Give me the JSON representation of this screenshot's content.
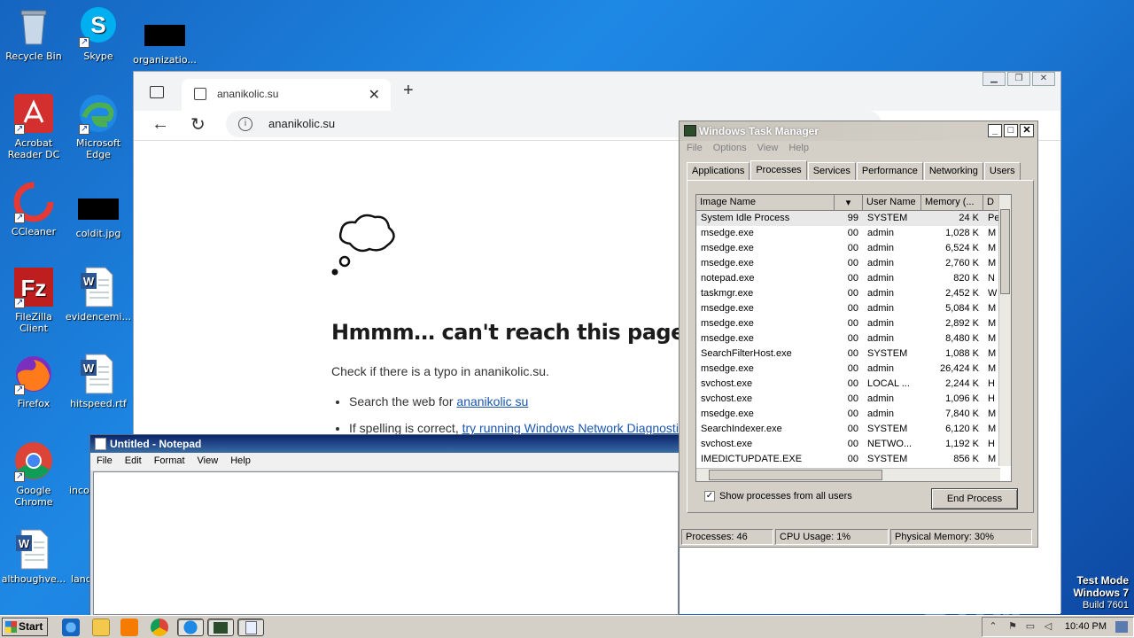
{
  "desktop": {
    "icons": [
      {
        "label": "Recycle Bin"
      },
      {
        "label": "Skype"
      },
      {
        "label": "organizatio..."
      },
      {
        "label": "Acrobat Reader DC"
      },
      {
        "label": "Microsoft Edge"
      },
      {
        "label": "CCleaner"
      },
      {
        "label": "coldit.jpg"
      },
      {
        "label": "FileZilla Client"
      },
      {
        "label": "evidencemi..."
      },
      {
        "label": "Firefox"
      },
      {
        "label": "hitspeed.rtf"
      },
      {
        "label": "Google Chrome"
      },
      {
        "label": "incon"
      },
      {
        "label": "althoughve..."
      },
      {
        "label": "land"
      }
    ]
  },
  "edge": {
    "tab_title": "ananikolic.su",
    "address": "ananikolic.su",
    "error": {
      "title": "Hmmm… can't reach this page",
      "subtitle": "Check if there is a typo in ananikolic.su.",
      "bullet1_prefix": "Search the web for ",
      "bullet1_link": "ananikolic su",
      "bullet2_prefix": "If spelling is correct, ",
      "bullet2_link": "try running Windows Network Diagnostic"
    }
  },
  "notepad": {
    "title": "Untitled - Notepad",
    "menu": [
      "File",
      "Edit",
      "Format",
      "View",
      "Help"
    ]
  },
  "taskmgr": {
    "title": "Windows Task Manager",
    "menu": [
      "File",
      "Options",
      "View",
      "Help"
    ],
    "tabs": [
      "Applications",
      "Processes",
      "Services",
      "Performance",
      "Networking",
      "Users"
    ],
    "active_tab": "Processes",
    "columns": [
      "Image Name",
      "",
      "User Name",
      "Memory (...",
      "D"
    ],
    "processes": [
      {
        "name": "System Idle Process",
        "cpu": "99",
        "user": "SYSTEM",
        "mem": "24 K",
        "d": "Pe"
      },
      {
        "name": "msedge.exe",
        "cpu": "00",
        "user": "admin",
        "mem": "1,028 K",
        "d": "M"
      },
      {
        "name": "msedge.exe",
        "cpu": "00",
        "user": "admin",
        "mem": "6,524 K",
        "d": "M"
      },
      {
        "name": "msedge.exe",
        "cpu": "00",
        "user": "admin",
        "mem": "2,760 K",
        "d": "M"
      },
      {
        "name": "notepad.exe",
        "cpu": "00",
        "user": "admin",
        "mem": "820 K",
        "d": "N"
      },
      {
        "name": "taskmgr.exe",
        "cpu": "00",
        "user": "admin",
        "mem": "2,452 K",
        "d": "W"
      },
      {
        "name": "msedge.exe",
        "cpu": "00",
        "user": "admin",
        "mem": "5,084 K",
        "d": "M"
      },
      {
        "name": "msedge.exe",
        "cpu": "00",
        "user": "admin",
        "mem": "2,892 K",
        "d": "M"
      },
      {
        "name": "msedge.exe",
        "cpu": "00",
        "user": "admin",
        "mem": "8,480 K",
        "d": "M"
      },
      {
        "name": "SearchFilterHost.exe",
        "cpu": "00",
        "user": "SYSTEM",
        "mem": "1,088 K",
        "d": "M"
      },
      {
        "name": "msedge.exe",
        "cpu": "00",
        "user": "admin",
        "mem": "26,424 K",
        "d": "M"
      },
      {
        "name": "svchost.exe",
        "cpu": "00",
        "user": "LOCAL ...",
        "mem": "2,244 K",
        "d": "H"
      },
      {
        "name": "svchost.exe",
        "cpu": "00",
        "user": "admin",
        "mem": "1,096 K",
        "d": "H"
      },
      {
        "name": "msedge.exe",
        "cpu": "00",
        "user": "admin",
        "mem": "7,840 K",
        "d": "M"
      },
      {
        "name": "SearchIndexer.exe",
        "cpu": "00",
        "user": "SYSTEM",
        "mem": "6,120 K",
        "d": "M"
      },
      {
        "name": "svchost.exe",
        "cpu": "00",
        "user": "NETWO...",
        "mem": "1,192 K",
        "d": "H"
      },
      {
        "name": "IMEDICTUPDATE.EXE",
        "cpu": "00",
        "user": "SYSTEM",
        "mem": "856 K",
        "d": "M"
      }
    ],
    "show_all_label": "Show processes from all users",
    "show_all_checked": true,
    "end_process_label": "End Process",
    "status": {
      "processes": "Processes: 46",
      "cpu": "CPU Usage: 1%",
      "memory": "Physical Memory: 30%"
    }
  },
  "overlay": {
    "watermark": "ANY RUN",
    "test_mode": "Test Mode",
    "os": "Windows 7",
    "build": "Build 7601"
  },
  "taskbar": {
    "start_label": "Start",
    "clock": "10:40 PM"
  }
}
